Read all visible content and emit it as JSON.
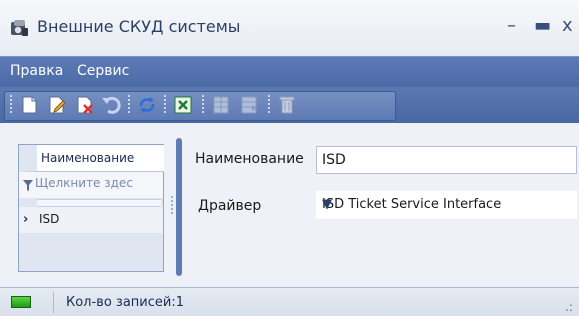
{
  "window": {
    "title": "Внешние СКУД системы",
    "minimize_glyph": "–",
    "maximize_glyph": "▬",
    "close_glyph": "x"
  },
  "menu": {
    "items": [
      {
        "label": "Правка"
      },
      {
        "label": "Сервис"
      }
    ]
  },
  "toolbar": {
    "buttons": [
      {
        "icon": "new-document-icon"
      },
      {
        "icon": "edit-document-icon"
      },
      {
        "icon": "delete-document-icon"
      },
      {
        "icon": "undo-icon"
      },
      {
        "icon": "refresh-icon"
      },
      {
        "icon": "excel-export-icon"
      },
      {
        "icon": "grid-layout-icon"
      },
      {
        "icon": "grid-columns-icon"
      },
      {
        "icon": "trash-icon"
      }
    ]
  },
  "grid": {
    "column_header": "Наименование",
    "filter_placeholder": "Щелкните здес",
    "rows": [
      {
        "indicator": "›",
        "name": "ISD"
      }
    ]
  },
  "form": {
    "name_label": "Наименование",
    "name_value": "ISD",
    "driver_label": "Драйвер",
    "driver_value": "ISD Ticket Service Interface"
  },
  "status": {
    "records_text": "Кол-во записей:1",
    "grip_glyph": ".:"
  },
  "colors": {
    "menubar": "#4f6eaa",
    "accent": "#5f7bb4",
    "status_led": "#2fb01f"
  }
}
